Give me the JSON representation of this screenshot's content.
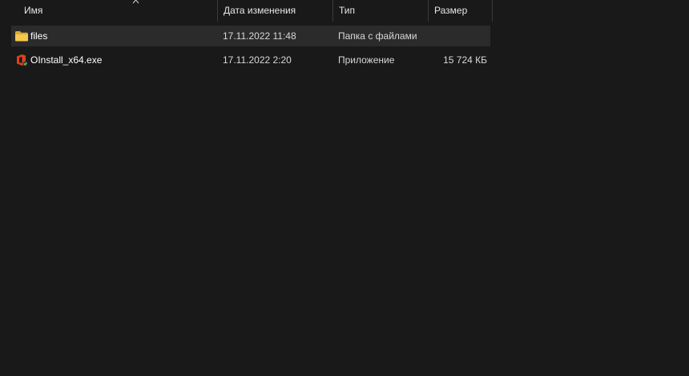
{
  "columns": {
    "name": "Имя",
    "date": "Дата изменения",
    "type": "Тип",
    "size": "Размер"
  },
  "sort": {
    "column": "name",
    "direction": "ascending"
  },
  "files": [
    {
      "name": "files",
      "date": "17.11.2022 11:48",
      "type": "Папка с файлами",
      "size": "",
      "icon": "folder-icon",
      "selected": true
    },
    {
      "name": "OInstall_x64.exe",
      "date": "17.11.2022 2:20",
      "type": "Приложение",
      "size": "15 724 КБ",
      "icon": "office-app-icon",
      "selected": false
    }
  ],
  "colors": {
    "background": "#191919",
    "selected_row": "#2b2b2b",
    "folder": "#f2c94c",
    "office_icon": "#e3481d"
  }
}
